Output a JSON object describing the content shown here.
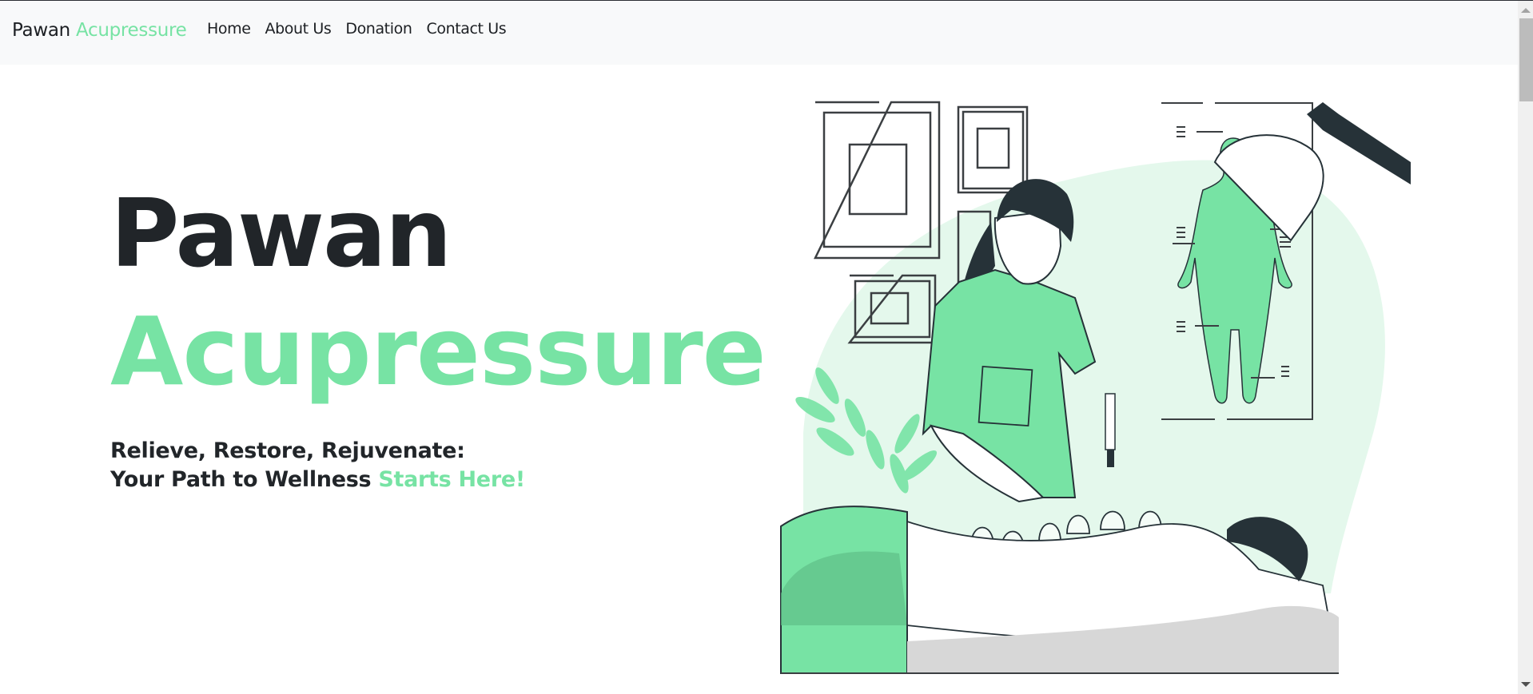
{
  "navbar": {
    "brand_primary": "Pawan",
    "brand_accent": "Acupressure",
    "links": [
      {
        "label": "Home"
      },
      {
        "label": "About Us"
      },
      {
        "label": "Donation"
      },
      {
        "label": "Contact Us"
      }
    ]
  },
  "hero": {
    "title_line1": "Pawan",
    "title_line2": "Acupressure",
    "tagline_line1": "Relieve, Restore, Rejuvenate:",
    "tagline_line2_prefix": "Your Path to Wellness ",
    "tagline_line2_accent": "Starts Here!",
    "illustration_subject": "acupressure-cupping-therapy-illustration"
  },
  "colors": {
    "accent": "#77e3a4",
    "accent_light": "#e4f8ec",
    "text_dark": "#212529",
    "navbar_bg": "#f8f9fa",
    "hair_dark": "#263238"
  }
}
